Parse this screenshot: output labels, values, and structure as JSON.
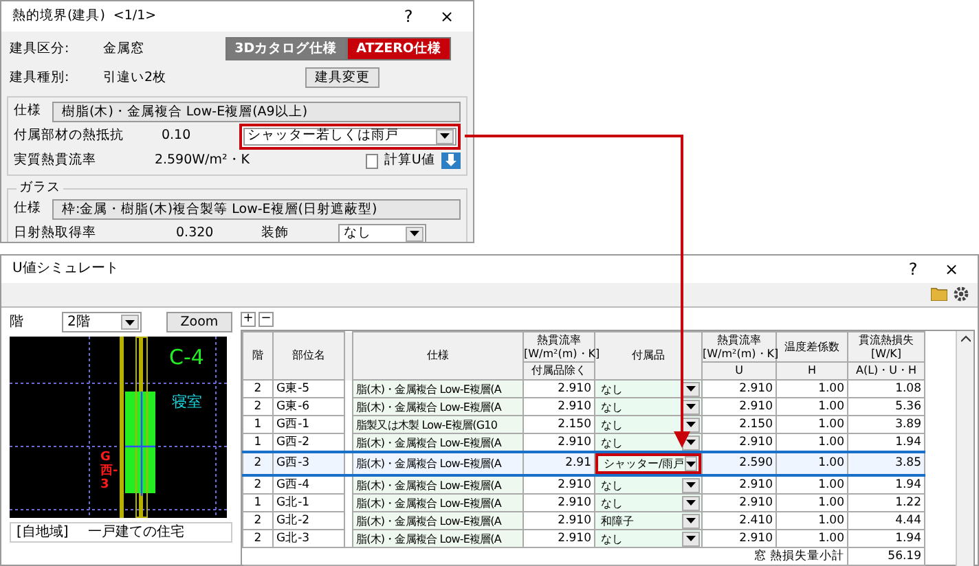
{
  "dialog": {
    "title": "熱的境界(建具)",
    "counter": "<1/1>",
    "help": "?",
    "close": "×",
    "fields": [
      {
        "label": "建具区分:",
        "value": "金属窓"
      },
      {
        "label": "建具種別:",
        "value": "引違い2枚"
      }
    ],
    "catalog_buttons": [
      {
        "label": "3Dカタログ仕様",
        "selected": false
      },
      {
        "label": "ATZERO仕様",
        "selected": true
      }
    ],
    "change_button": "建具変更",
    "frame": {
      "spec_label": "仕様",
      "spec": "樹脂(木)・金属複合 Low-E複層(A9以上)",
      "resistance_label": "付属部材の熱抵抗",
      "resistance": "0.10",
      "accessory": {
        "value": "シャッター若しくは雨戸",
        "highlighted": true
      },
      "u_label": "実質熱貫流率",
      "u_value": "2.590",
      "u_unit": "W/m²・K",
      "calc_u": {
        "label": "計算U値",
        "checked": false
      }
    },
    "glass": {
      "title": "ガラス",
      "spec_label": "仕様",
      "spec": "枠:金属・樹脂(木)複合製等 Low-E複層(日射遮蔽型)",
      "gain_label": "日射熱取得率",
      "gain": "0.320",
      "decor_label": "装飾",
      "decor": "なし"
    }
  },
  "simulator": {
    "title": "U値シミュレート",
    "help": "?",
    "close": "×",
    "floor_label": "階",
    "floor": "2階",
    "zoom": "Zoom",
    "add": "+",
    "remove": "−",
    "plan": {
      "room_code": "C-4",
      "room_name": "寝室",
      "window_label": "G西-3"
    },
    "info": [
      "[自地域]",
      "一戸建ての住宅"
    ],
    "table": {
      "columns": [
        {
          "label": "階"
        },
        {
          "label": "部位名"
        },
        {
          "label": "仕様"
        },
        {
          "label": "熱貫流率",
          "unit": "[W/m²(m)・K]",
          "sub": "付属品除く"
        },
        {
          "label": "付属品"
        },
        {
          "label": "熱貫流率",
          "unit": "[W/m²(m)・K]",
          "sub": "U"
        },
        {
          "label": "温度差係数",
          "sub": "H"
        },
        {
          "label": "貫流熱損失",
          "unit": "[W/K]",
          "sub": "A(L)・U・H"
        }
      ],
      "rows": [
        {
          "floor": "2",
          "name": "G東-5",
          "spec": "脂(木)・金属複合 Low-E複層(A",
          "u_base": "2.910",
          "accessory": "なし",
          "u": "2.910",
          "h": "1.00",
          "loss": "1.08",
          "selected": false,
          "highlighted": false
        },
        {
          "floor": "2",
          "name": "G東-6",
          "spec": "脂(木)・金属複合 Low-E複層(A",
          "u_base": "2.910",
          "accessory": "なし",
          "u": "2.910",
          "h": "1.00",
          "loss": "5.36",
          "selected": false,
          "highlighted": false
        },
        {
          "floor": "1",
          "name": "G西-1",
          "spec": "脂製又は木製 Low-E複層(G10",
          "u_base": "2.150",
          "accessory": "なし",
          "u": "2.150",
          "h": "1.00",
          "loss": "3.89",
          "selected": false,
          "highlighted": false
        },
        {
          "floor": "1",
          "name": "G西-2",
          "spec": "脂(木)・金属複合 Low-E複層(A",
          "u_base": "2.910",
          "accessory": "なし",
          "u": "2.910",
          "h": "1.00",
          "loss": "1.94",
          "selected": false,
          "highlighted": false
        },
        {
          "floor": "2",
          "name": "G西-3",
          "spec": "脂(木)・金属複合 Low-E複層(A",
          "u_base": "2.91",
          "accessory": "シャッター/雨戸",
          "u": "2.590",
          "h": "1.00",
          "loss": "3.85",
          "selected": true,
          "highlighted": true
        },
        {
          "floor": "2",
          "name": "G西-4",
          "spec": "脂(木)・金属複合 Low-E複層(A",
          "u_base": "2.910",
          "accessory": "なし",
          "u": "2.910",
          "h": "1.00",
          "loss": "1.94",
          "selected": false,
          "highlighted": false
        },
        {
          "floor": "1",
          "name": "G北-1",
          "spec": "脂(木)・金属複合 Low-E複層(A",
          "u_base": "2.910",
          "accessory": "なし",
          "u": "2.910",
          "h": "1.00",
          "loss": "1.22",
          "selected": false,
          "highlighted": false
        },
        {
          "floor": "2",
          "name": "G北-2",
          "spec": "脂(木)・金属複合 Low-E複層(A",
          "u_base": "2.910",
          "accessory": "和障子",
          "u": "2.410",
          "h": "1.00",
          "loss": "4.44",
          "selected": false,
          "highlighted": false
        },
        {
          "floor": "2",
          "name": "G北-3",
          "spec": "脂(木)・金属複合 Low-E複層(A",
          "u_base": "2.910",
          "accessory": "なし",
          "u": "2.910",
          "h": "1.00",
          "loss": "1.94",
          "selected": false,
          "highlighted": false
        }
      ],
      "footer_label": "窓 熱損失量小計",
      "total": "56.19"
    }
  }
}
